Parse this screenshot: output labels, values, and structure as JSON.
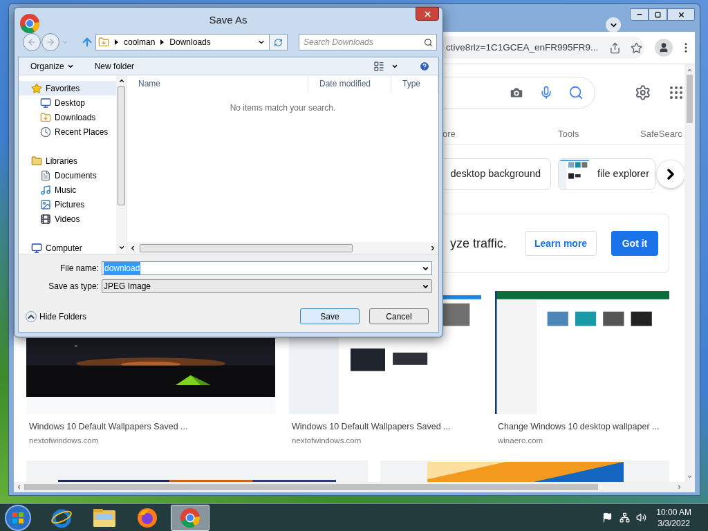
{
  "browser": {
    "address": "ctive8rlz=1C1GCEA_enFR995FR9...",
    "search_tabs": [
      "ore",
      "Tools",
      "SafeSearc"
    ],
    "chips": [
      {
        "label": "desktop background",
        "thumbnail": false
      },
      {
        "label": "file explorer",
        "thumbnail": true
      }
    ],
    "consent": {
      "text": "yze traffic.",
      "buttons": [
        {
          "label": "Learn more",
          "kind": "outline"
        },
        {
          "label": "Got it",
          "kind": "primary"
        }
      ]
    },
    "results": [
      {
        "kind": "picture",
        "title": "Windows 10 Default Wallpapers Saved ...",
        "source": "nextofwindows.com"
      },
      {
        "kind": "picture",
        "title": "Windows 10 Default Wallpapers Saved ...",
        "source": "nextofwindows.com"
      },
      {
        "kind": "picture",
        "title": "Change Windows 10 desktop wallpaper ...",
        "source": "winaero.com"
      }
    ],
    "more_results": [
      {
        "kind": "picture"
      },
      {
        "kind": "picture"
      }
    ]
  },
  "dialog": {
    "title": "Save As",
    "breadcrumb": [
      "coolman",
      "Downloads"
    ],
    "search": {
      "placeholder": "Search Downloads"
    },
    "toolbar": [
      {
        "label": "Organize",
        "menu": true
      },
      {
        "label": "New folder",
        "menu": false
      }
    ],
    "nav": [
      {
        "label": "Favorites",
        "kind": "star",
        "selected": true,
        "children": [
          {
            "label": "Desktop",
            "kind": "desktop",
            "selected": false
          },
          {
            "label": "Downloads",
            "kind": "downloads",
            "selected": false
          },
          {
            "label": "Recent Places",
            "kind": "recent",
            "selected": false
          }
        ]
      },
      {
        "label": "Libraries",
        "kind": "library",
        "selected": false,
        "children": [
          {
            "label": "Documents",
            "kind": "document",
            "selected": false
          },
          {
            "label": "Music",
            "kind": "music",
            "selected": false
          },
          {
            "label": "Pictures",
            "kind": "pictures",
            "selected": false
          },
          {
            "label": "Videos",
            "kind": "videos",
            "selected": false
          }
        ]
      },
      {
        "label": "Computer",
        "kind": "computer",
        "selected": false
      }
    ],
    "columns": [
      "Name",
      "Date modified",
      "Type"
    ],
    "empty_message": "No items match your search.",
    "file_name": {
      "label": "File name:",
      "value": "download",
      "selected": true
    },
    "save_type": {
      "label": "Save as type:",
      "value": "JPEG Image"
    },
    "hide_folders": "Hide Folders",
    "buttons": [
      {
        "label": "Save",
        "kind": "default"
      },
      {
        "label": "Cancel",
        "kind": "normal"
      }
    ]
  },
  "taskbar": {
    "apps": [
      {
        "kind": "ie",
        "selected": false
      },
      {
        "kind": "explorer",
        "selected": false
      },
      {
        "kind": "firefox",
        "selected": false
      },
      {
        "kind": "chrome",
        "selected": true
      }
    ],
    "time": "10:00 AM",
    "date": "3/3/2022"
  }
}
